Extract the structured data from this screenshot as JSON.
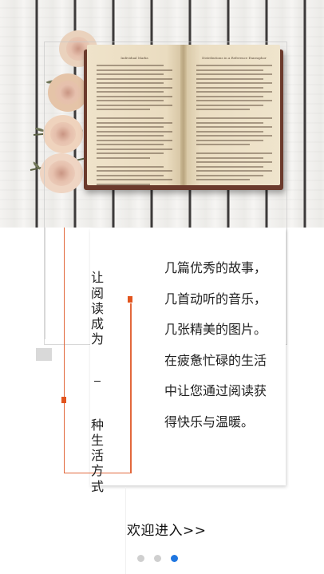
{
  "hero": {
    "image": "open-book-with-dried-roses-on-white-wood",
    "book": {
      "left_page_heading": "Individual Marks",
      "right_page_heading": "Distributions in a Reference Enneaphor"
    }
  },
  "title": {
    "part1": "让阅读成为",
    "part2": "种生活方式"
  },
  "copy": {
    "lines": [
      "几篇优秀的故事，",
      "几首动听的音乐，",
      "几张精美的图片。",
      "在疲惫忙碌的生活",
      "中让您通过阅读获",
      "得快乐与温暖。"
    ]
  },
  "enter_label": "欢迎进入>>",
  "pagination": {
    "count": 3,
    "active_index": 2,
    "active_color": "#1f76e0",
    "inactive_color": "#cfcfcf"
  },
  "colors": {
    "accent": "#e2683c",
    "accent_dark": "#e2541d"
  }
}
